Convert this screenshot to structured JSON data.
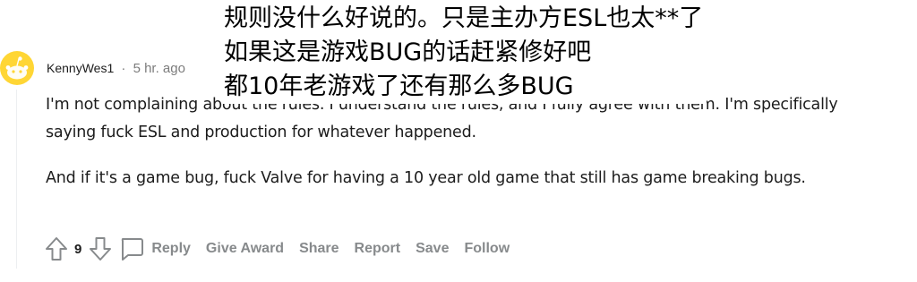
{
  "overlay_caption": {
    "line1": "规则没什么好说的。只是主办方ESL也太**了",
    "line2": "如果这是游戏BUG的话赶紧修好吧",
    "line3": "都10年老游戏了还有那么多BUG"
  },
  "comment": {
    "username": "KennyWes1",
    "separator": "·",
    "timestamp": "5 hr. ago",
    "paragraph1": "I'm not complaining about the rules. I understand the rules, and I fully agree with them. I'm specifically saying fuck ESL and production for whatever happened.",
    "paragraph2": "And if it's a game bug, fuck Valve for having a 10 year old game that still has game breaking bugs."
  },
  "actions": {
    "score": "9",
    "reply": "Reply",
    "give_award": "Give Award",
    "share": "Share",
    "report": "Report",
    "save": "Save",
    "follow": "Follow"
  },
  "icons": {
    "avatar": "snoo-avatar-icon",
    "upvote": "upvote-arrow-icon",
    "downvote": "downvote-arrow-icon",
    "reply": "speech-bubble-icon"
  },
  "colors": {
    "avatar_yellow": "#ffd635",
    "meta_grey": "#7c7c7c",
    "action_grey": "#878a8c",
    "text": "#1c1c1c"
  }
}
